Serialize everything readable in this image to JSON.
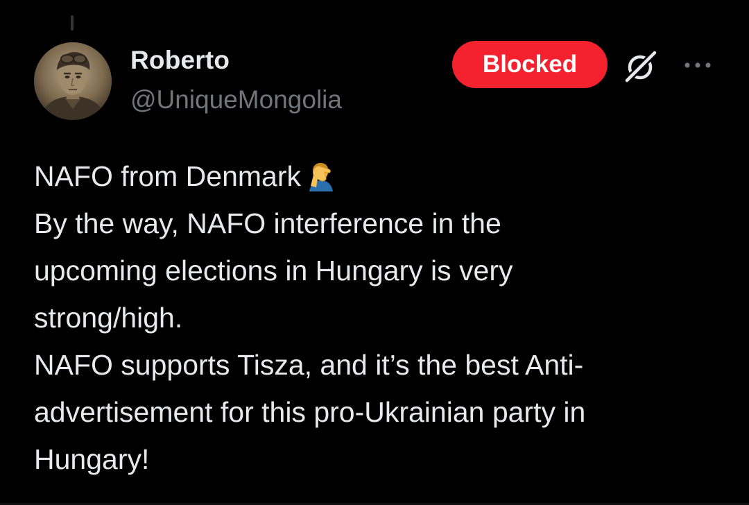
{
  "author": {
    "display_name": "Roberto",
    "handle": "@UniqueMongolia"
  },
  "actions": {
    "blocked_label": "Blocked",
    "grok_icon": "grok-icon",
    "more_icon": "more-icon"
  },
  "tweet": {
    "lines": [
      "NAFO from Denmark",
      "By the way, NAFO interference in the",
      "upcoming elections in Hungary is very",
      "strong/high.",
      "NAFO supports Tisza, and it’s the best Anti-",
      "advertisement for this pro-Ukrainian party in",
      "Hungary!"
    ],
    "emoji": "face-palm-emoji"
  },
  "colors": {
    "background": "#000000",
    "text": "#e7e9ea",
    "secondary_text": "#71767b",
    "blocked_button": "#f4212e"
  }
}
